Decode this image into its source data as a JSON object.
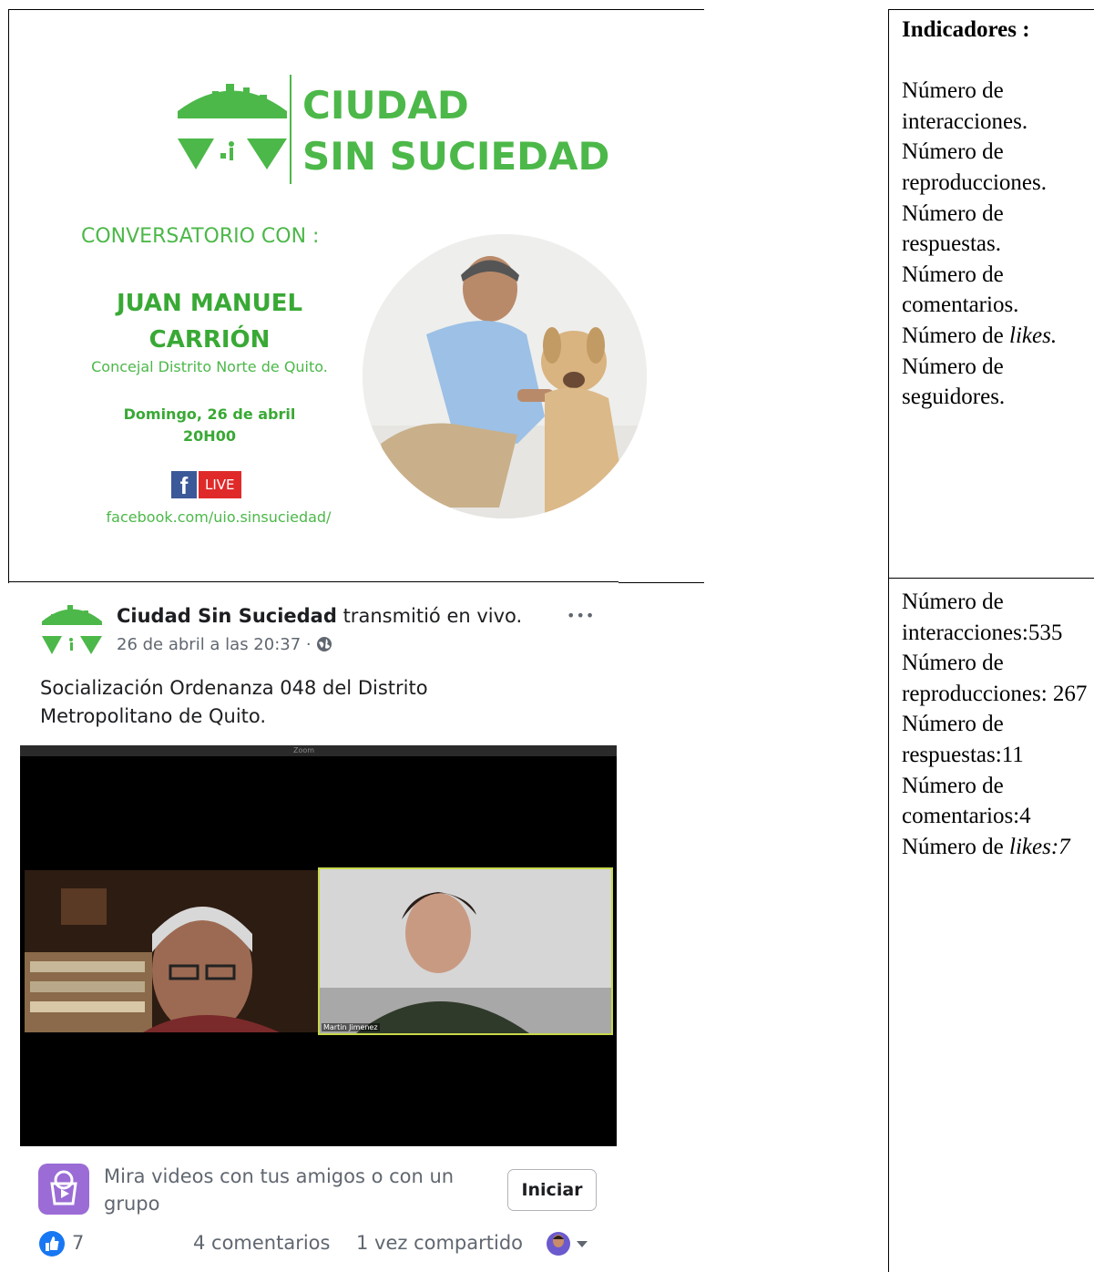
{
  "poster": {
    "brand_line1": "CIUDAD",
    "brand_line2": "SIN SUCIEDAD",
    "conversatorio": "CONVERSATORIO CON :",
    "speaker_line1": "JUAN MANUEL",
    "speaker_line2": "CARRIÓN",
    "speaker_role": "Concejal Distrito Norte de Quito.",
    "date": "Domingo, 26 de abril",
    "time": "20H00",
    "fb_letter": "f",
    "live_badge": "LIVE",
    "url": "facebook.com/uio.sinsuciedad/"
  },
  "indicators_top": {
    "header": "Indicadores :",
    "items": [
      "Número de interacciones.",
      "Número de reproducciones.",
      "Número de respuestas.",
      "Número de comentarios.",
      "Número de",
      "Número de seguidores."
    ],
    "likes_word": "likes."
  },
  "indicators_bottom": {
    "items": [
      "Número de interacciones:535",
      "Número de reproducciones: 267",
      "Número de respuestas:11",
      "Número de comentarios:4",
      "Número de"
    ],
    "likes_value": "likes:7"
  },
  "post": {
    "page_name": "Ciudad Sin Suciedad",
    "action": "transmitió en vivo.",
    "timestamp": "26 de abril a las 20:37 ·",
    "more": "•••",
    "caption_line1": "Socialización Ordenanza 048 del Distrito",
    "caption_line2": "Metropolitano de Quito.",
    "video_window_title": "Zoom",
    "participant_name": "Martin Jimenez",
    "watch_together_line1": "Mira videos con tus amigos o con un",
    "watch_together_line2": "grupo",
    "start_button": "Iniciar",
    "like_count": "7",
    "comments": "4 comentarios",
    "shares": "1 vez compartido"
  },
  "colors": {
    "brand_green": "#4cb849",
    "facebook_blue": "#1877f2",
    "live_red": "#e02a2a",
    "purple_icon": "#9b6bd6"
  }
}
